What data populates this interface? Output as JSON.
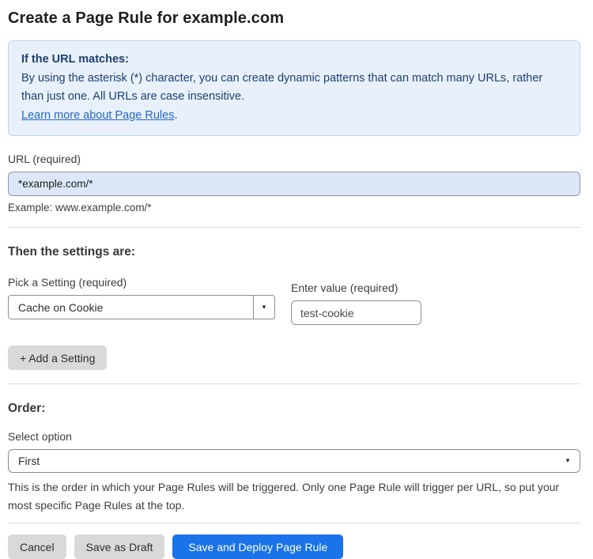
{
  "page": {
    "title": "Create a Page Rule for example.com"
  },
  "info_box": {
    "heading": "If the URL matches:",
    "body": "By using the asterisk (*) character, you can create dynamic patterns that can match many URLs, rather than just one. All URLs are case insensitive.",
    "link_label": "Learn more about Page Rules",
    "link_suffix": "."
  },
  "url_field": {
    "label": "URL (required)",
    "value": "*example.com/*",
    "example": "Example: www.example.com/*"
  },
  "settings": {
    "heading": "Then the settings are:",
    "setting_label": "Pick a Setting (required)",
    "setting_selected": "Cache on Cookie",
    "value_label": "Enter value (required)",
    "value_value": "test-cookie",
    "add_button_label": "+ Add a Setting"
  },
  "order": {
    "heading": "Order:",
    "select_label": "Select option",
    "selected": "First",
    "help": "This is the order in which your Page Rules will be triggered. Only one Page Rule will trigger per URL, so put your most specific Page Rules at the top."
  },
  "footer": {
    "cancel_label": "Cancel",
    "save_draft_label": "Save as Draft",
    "save_deploy_label": "Save and Deploy Page Rule"
  },
  "icons": {
    "dropdown_arrow": "▼",
    "select_chevron": "▼"
  },
  "colors": {
    "accent_blue": "#1a73e8",
    "info_bg": "#e8f1fb",
    "info_border": "#b8d4f0",
    "info_text": "#1e3f72",
    "link_blue": "#2667c9",
    "url_input_bg": "#dce8f8",
    "button_gray": "#d9d9d9"
  }
}
